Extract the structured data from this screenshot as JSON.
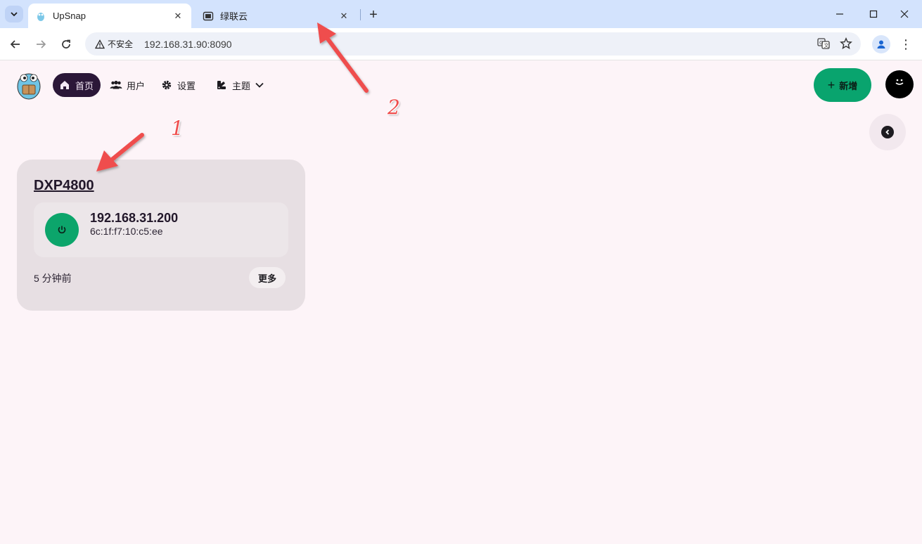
{
  "browser": {
    "tabs": [
      {
        "label": "UpSnap",
        "active": true
      },
      {
        "label": "绿联云",
        "active": false
      }
    ],
    "security_label": "不安全",
    "url": "192.168.31.90:8090",
    "colors": {
      "tabbar": "#d3e3fd",
      "omnibox": "#eef1f8"
    }
  },
  "app": {
    "nav": {
      "home": "首页",
      "users": "用户",
      "settings": "设置",
      "theme": "主题"
    },
    "add_button": "新增",
    "device": {
      "name": "DXP4800",
      "ip": "192.168.31.200",
      "mac": "6c:1f:f7:10:c5:ee",
      "last_seen": "5 分钟前",
      "more_label": "更多"
    },
    "colors": {
      "accent_green": "#09a46e",
      "nav_active": "#2b1738",
      "background": "#fdf4f8",
      "card": "#e7dfe3"
    }
  },
  "annotations": {
    "marker_1": "1",
    "marker_2": "2",
    "color": "#ef4d4d"
  }
}
